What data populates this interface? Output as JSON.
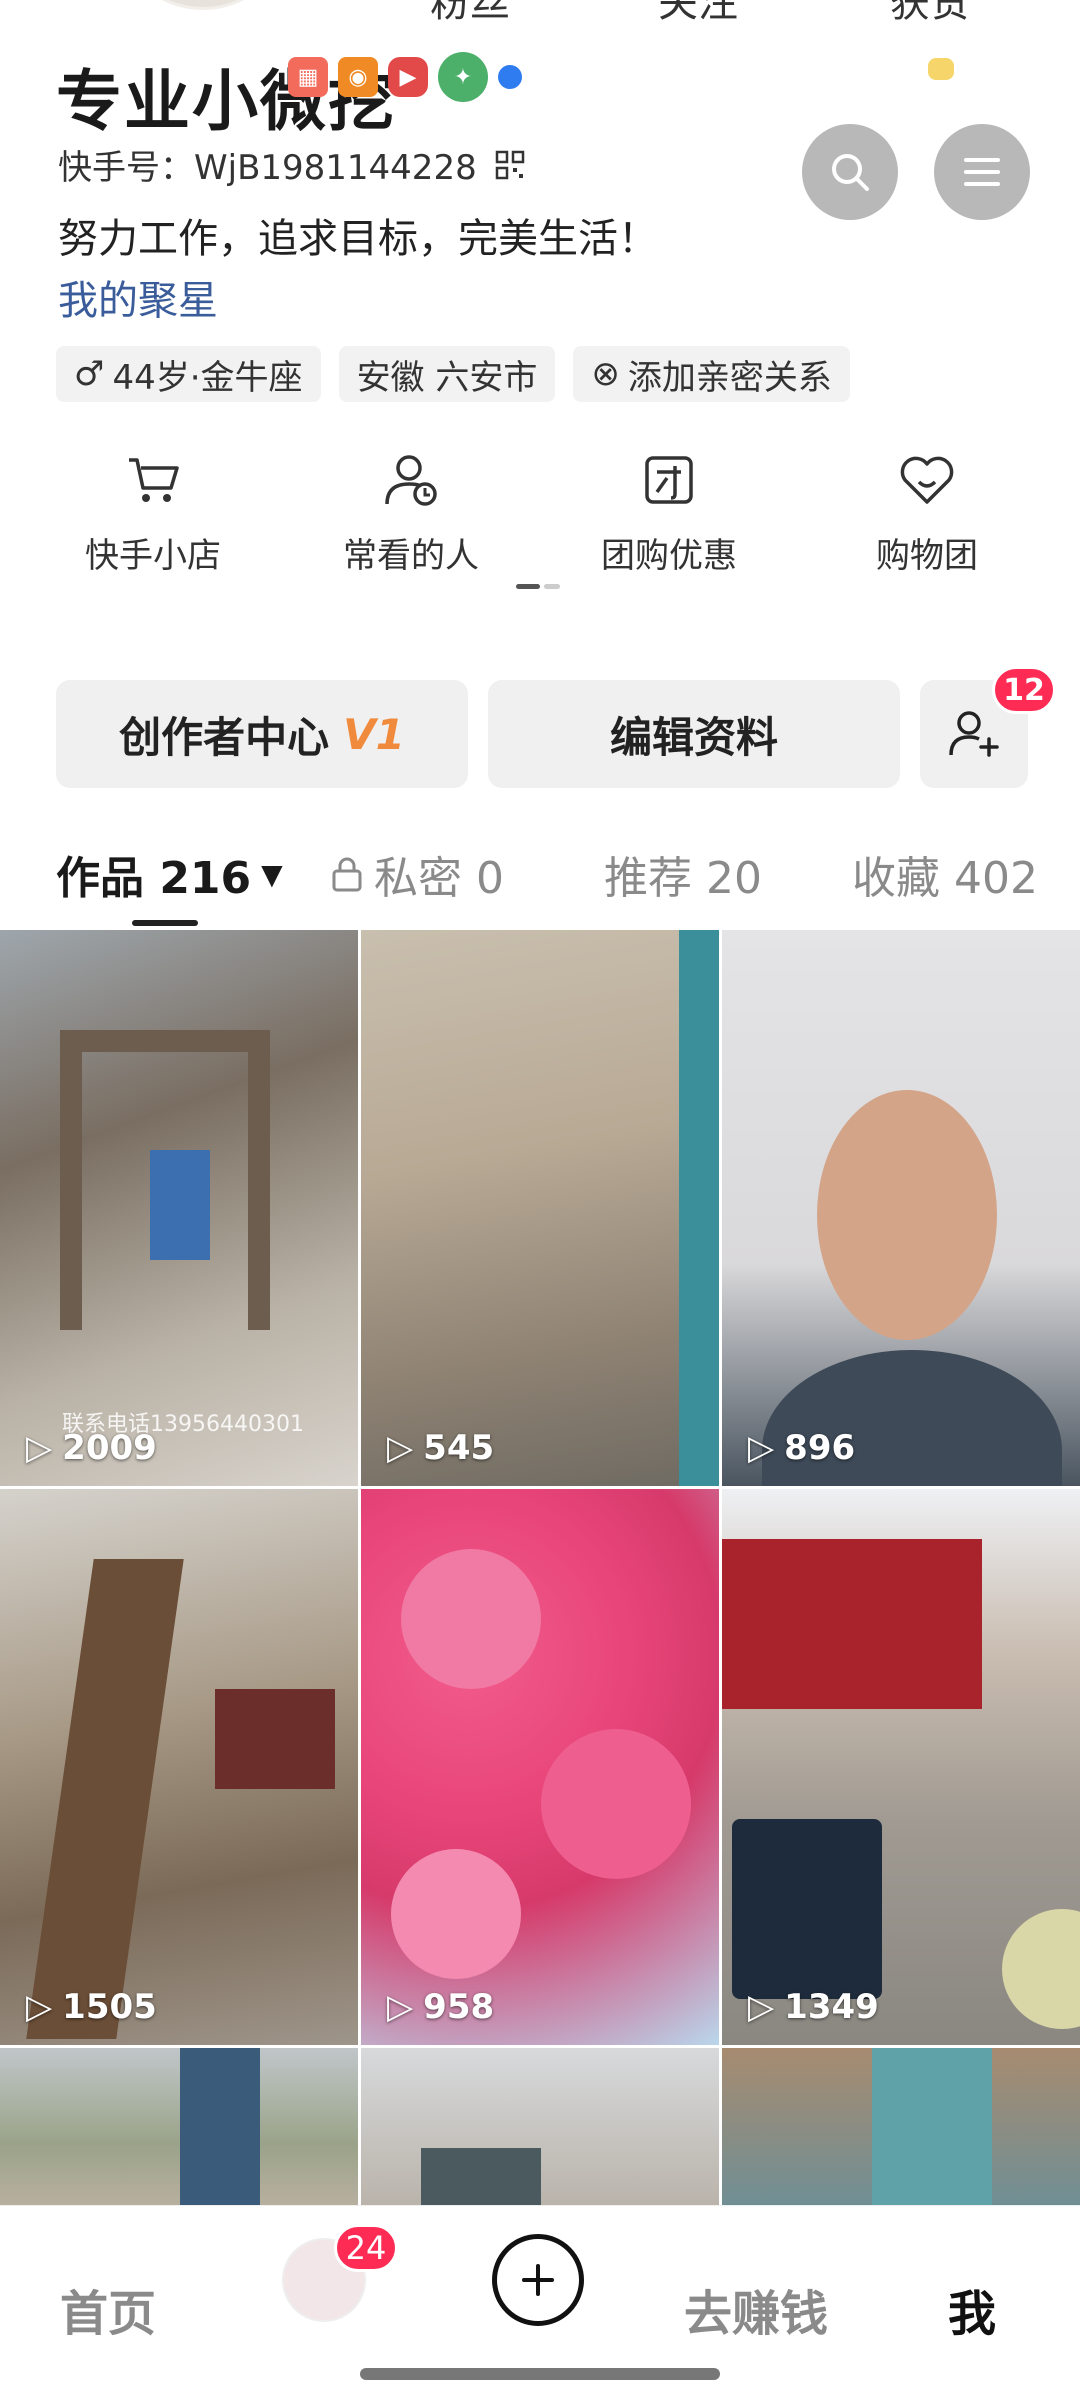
{
  "top_cut": {
    "labels": [
      "粉丝",
      "关注",
      "获赞"
    ]
  },
  "profile": {
    "name": "专业小微挖",
    "kwai_id": "快手号：WjB1981144228",
    "bio": "努力工作，追求目标，完美生活！",
    "fan_group": "我的聚星",
    "tags": [
      "44岁·金牛座",
      "安徽 六安市",
      "添加亲密关系"
    ]
  },
  "quick_actions": [
    {
      "label": "快手小店",
      "icon": "cart-icon"
    },
    {
      "label": "常看的人",
      "icon": "person-clock-icon"
    },
    {
      "label": "团购优惠",
      "icon": "group-buy-icon"
    },
    {
      "label": "购物团",
      "icon": "heart-shop-icon"
    }
  ],
  "actions": {
    "creator_center": "创作者中心",
    "creator_level": "V1",
    "edit_profile": "编辑资料",
    "friend_badge": "12"
  },
  "tabs": [
    {
      "label": "作品 216",
      "active": true
    },
    {
      "label": "私密 0",
      "active": false
    },
    {
      "label": "推荐 20",
      "active": false
    },
    {
      "label": "收藏 402",
      "active": false
    }
  ],
  "videos": [
    {
      "count": "2009",
      "watermark": "联系电话13956440301"
    },
    {
      "count": "545"
    },
    {
      "count": "896"
    },
    {
      "count": "1505"
    },
    {
      "count": "958"
    },
    {
      "count": "1349"
    },
    {
      "count": ""
    },
    {
      "count": ""
    },
    {
      "count": ""
    }
  ],
  "bottom_nav": {
    "home": "首页",
    "avatar_badge": "24",
    "earn": "去赚钱",
    "me": "我"
  },
  "colors": {
    "accent": "#fe2c55",
    "link": "#3b5c9a",
    "level": "#f08a3c"
  }
}
